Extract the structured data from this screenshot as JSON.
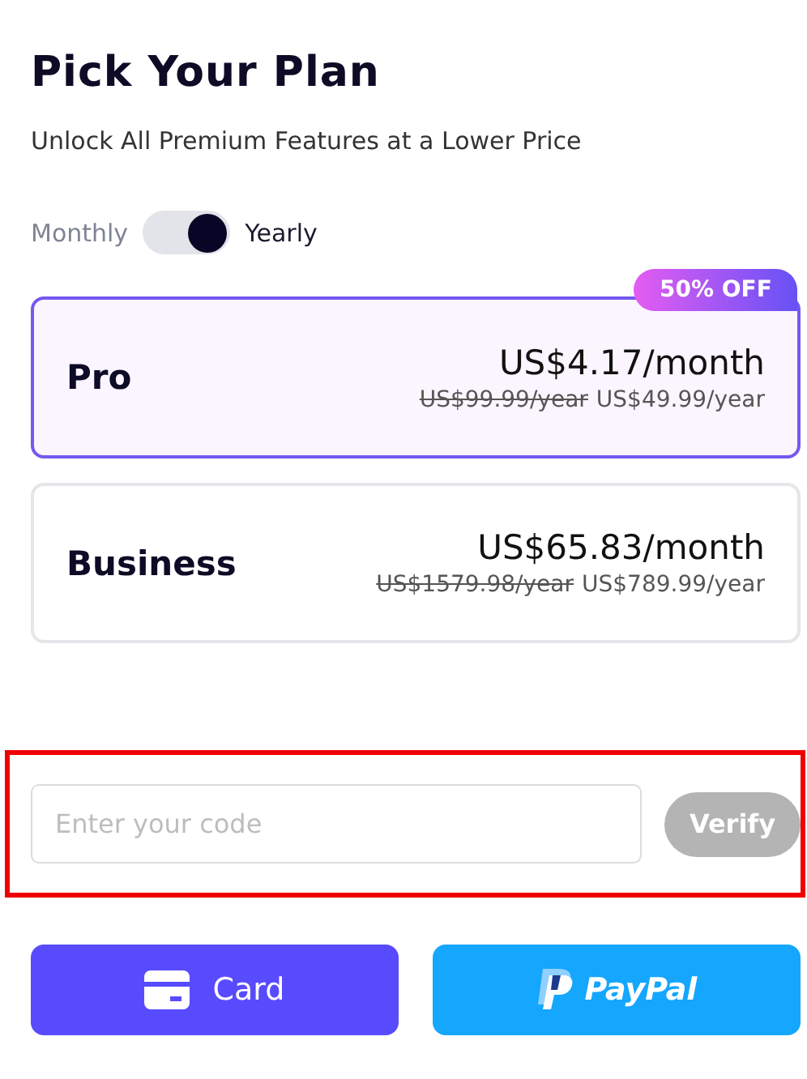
{
  "title": "Pick Your Plan",
  "subtitle": "Unlock All Premium Features at a Lower Price",
  "billing": {
    "left_label": "Monthly",
    "right_label": "Yearly",
    "on": true
  },
  "plans": [
    {
      "name": "Pro",
      "price": "US$4.17/month",
      "old_price": "US$99.99/year",
      "new_price": "US$49.99/year",
      "badge": "50% OFF",
      "selected": true
    },
    {
      "name": "Business",
      "price": "US$65.83/month",
      "old_price": "US$1579.98/year",
      "new_price": "US$789.99/year",
      "selected": false
    }
  ],
  "promo": {
    "placeholder": "Enter your code",
    "verify": "Verify",
    "disabled": true,
    "highlighted": true
  },
  "payment_buttons": [
    {
      "kind": "card",
      "label": "Card"
    },
    {
      "kind": "paypal",
      "label": "PayPal"
    }
  ]
}
